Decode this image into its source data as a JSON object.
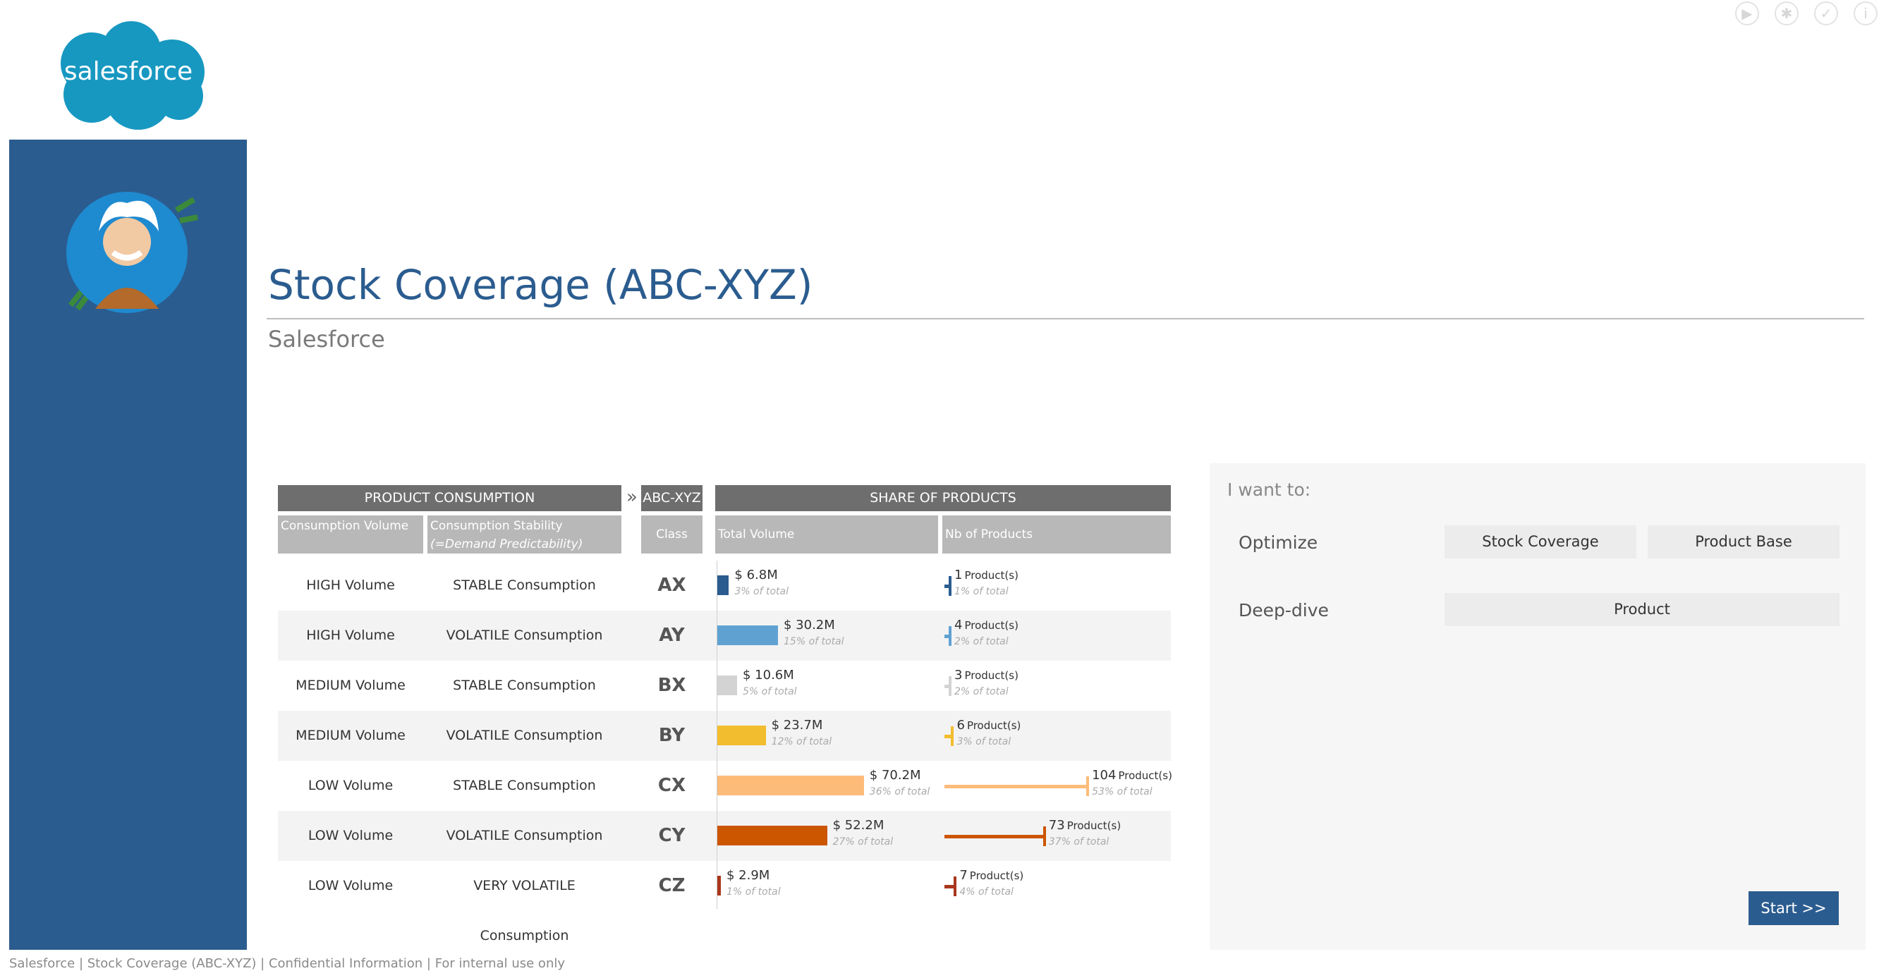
{
  "colors": {
    "brand_blue": "#2b5c8f",
    "salesforce_cloud": "#1798c1",
    "AX": "#2b5c8f",
    "AY": "#5fa2d2",
    "BX": "#d3d3d3",
    "BY": "#f2bd2e",
    "CX": "#fdbb7a",
    "CY": "#cc5500",
    "CZ": "#a9361c"
  },
  "toolbar": {
    "icons": [
      "play-icon",
      "settings-icon",
      "check-icon",
      "info-icon"
    ]
  },
  "logo_text": "salesforce",
  "title": "Stock Coverage (ABC-XYZ)",
  "subtitle": "Salesforce",
  "table": {
    "header_consumption": "PRODUCT CONSUMPTION",
    "arrows": "»",
    "header_abcxyz": "ABC-XYZ",
    "header_share": "SHARE OF PRODUCTS",
    "sub_volume": "Consumption Volume",
    "sub_stability": "Consumption Stability",
    "sub_stability_note": "(=Demand Predictability)",
    "sub_class": "Class",
    "sub_total_volume": "Total Volume",
    "sub_nb_products": "Nb of Products",
    "rows": [
      {
        "volume": "HIGH Volume",
        "stability": "STABLE Consumption",
        "cls": "AX",
        "total": "$ 6.8M",
        "total_pct": "3% of total",
        "total_share": 0.03,
        "nb": "1",
        "nb_suffix": "Product(s)",
        "nb_pct": "1% of total",
        "nb_share": 0.01
      },
      {
        "volume": "HIGH Volume",
        "stability": "VOLATILE Consumption",
        "cls": "AY",
        "total": "$ 30.2M",
        "total_pct": "15% of total",
        "total_share": 0.15,
        "nb": "4",
        "nb_suffix": "Product(s)",
        "nb_pct": "2% of total",
        "nb_share": 0.02
      },
      {
        "volume": "MEDIUM Volume",
        "stability": "STABLE Consumption",
        "cls": "BX",
        "total": "$ 10.6M",
        "total_pct": "5% of total",
        "total_share": 0.05,
        "nb": "3",
        "nb_suffix": "Product(s)",
        "nb_pct": "2% of total",
        "nb_share": 0.02
      },
      {
        "volume": "MEDIUM Volume",
        "stability": "VOLATILE Consumption",
        "cls": "BY",
        "total": "$ 23.7M",
        "total_pct": "12% of total",
        "total_share": 0.12,
        "nb": "6",
        "nb_suffix": "Product(s)",
        "nb_pct": "3% of total",
        "nb_share": 0.03
      },
      {
        "volume": "LOW Volume",
        "stability": "STABLE Consumption",
        "cls": "CX",
        "total": "$ 70.2M",
        "total_pct": "36% of total",
        "total_share": 0.36,
        "nb": "104",
        "nb_suffix": "Product(s)",
        "nb_pct": "53% of total",
        "nb_share": 0.53
      },
      {
        "volume": "LOW Volume",
        "stability": "VOLATILE Consumption",
        "cls": "CY",
        "total": "$ 52.2M",
        "total_pct": "27% of total",
        "total_share": 0.27,
        "nb": "73",
        "nb_suffix": "Product(s)",
        "nb_pct": "37% of total",
        "nb_share": 0.37
      },
      {
        "volume": "LOW Volume",
        "stability": "VERY VOLATILE Consumption",
        "cls": "CZ",
        "total": "$ 2.9M",
        "total_pct": "1% of total",
        "total_share": 0.01,
        "nb": "7",
        "nb_suffix": "Product(s)",
        "nb_pct": "4% of total",
        "nb_share": 0.04
      }
    ]
  },
  "panel": {
    "want": "I want to:",
    "optimize_label": "Optimize",
    "stock_coverage_button": "Stock Coverage",
    "product_base_button": "Product Base",
    "deepdive_label": "Deep-dive",
    "product_button": "Product",
    "start_button": "Start >>"
  },
  "footer": "Salesforce | Stock Coverage (ABC-XYZ) | Confidential Information | For internal use only"
}
